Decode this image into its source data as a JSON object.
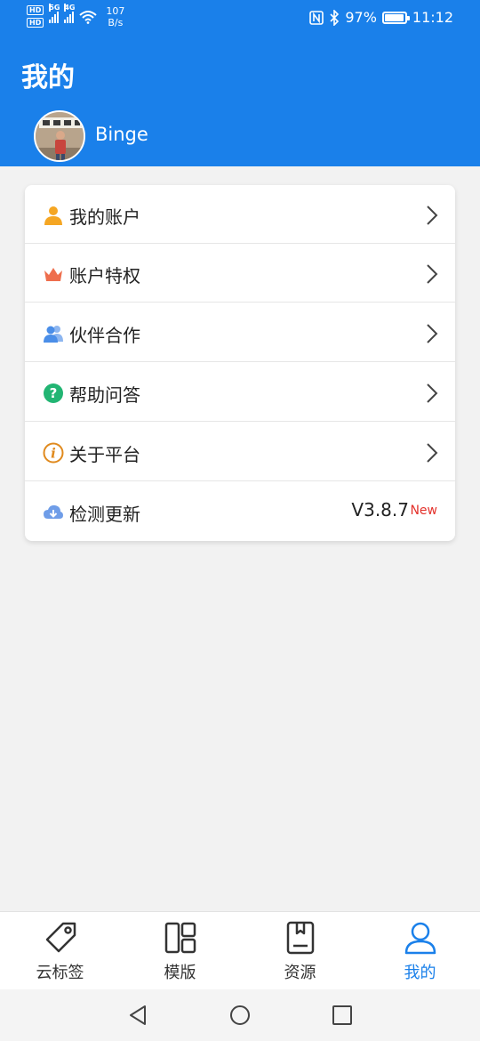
{
  "status_bar": {
    "hd1": "HD",
    "hd2": "HD",
    "net1": "5G",
    "net2": "4G",
    "speed_value": "107",
    "speed_unit": "B/s",
    "battery_percent": "97%",
    "battery_level": 0.97,
    "time": "11:12"
  },
  "header": {
    "title": "我的",
    "username": "Binge",
    "background_color": "#1a80ea"
  },
  "menu": {
    "items": [
      {
        "label": "我的账户",
        "icon": "user-icon",
        "icon_color": "#f5a623"
      },
      {
        "label": "账户特权",
        "icon": "crown-icon",
        "icon_color": "#ee6e4d"
      },
      {
        "label": "伙伴合作",
        "icon": "partners-icon",
        "icon_color": "#4a8ee8"
      },
      {
        "label": "帮助问答",
        "icon": "help-icon",
        "icon_color": "#22b573"
      },
      {
        "label": "关于平台",
        "icon": "info-icon",
        "icon_color": "#e08a1e"
      },
      {
        "label": "检测更新",
        "icon": "cloud-download-icon",
        "icon_color": "#6f9de8"
      }
    ],
    "version": "V3.8.7",
    "new_badge": "New"
  },
  "tabs": [
    {
      "label": "云标签",
      "icon": "tag-icon",
      "active": false
    },
    {
      "label": "模版",
      "icon": "template-icon",
      "active": false
    },
    {
      "label": "资源",
      "icon": "book-icon",
      "active": false
    },
    {
      "label": "我的",
      "icon": "person-icon",
      "active": true
    }
  ],
  "accent_color": "#1a80ea",
  "nav": {
    "back": "back-icon",
    "home": "home-icon",
    "recents": "recents-icon"
  }
}
